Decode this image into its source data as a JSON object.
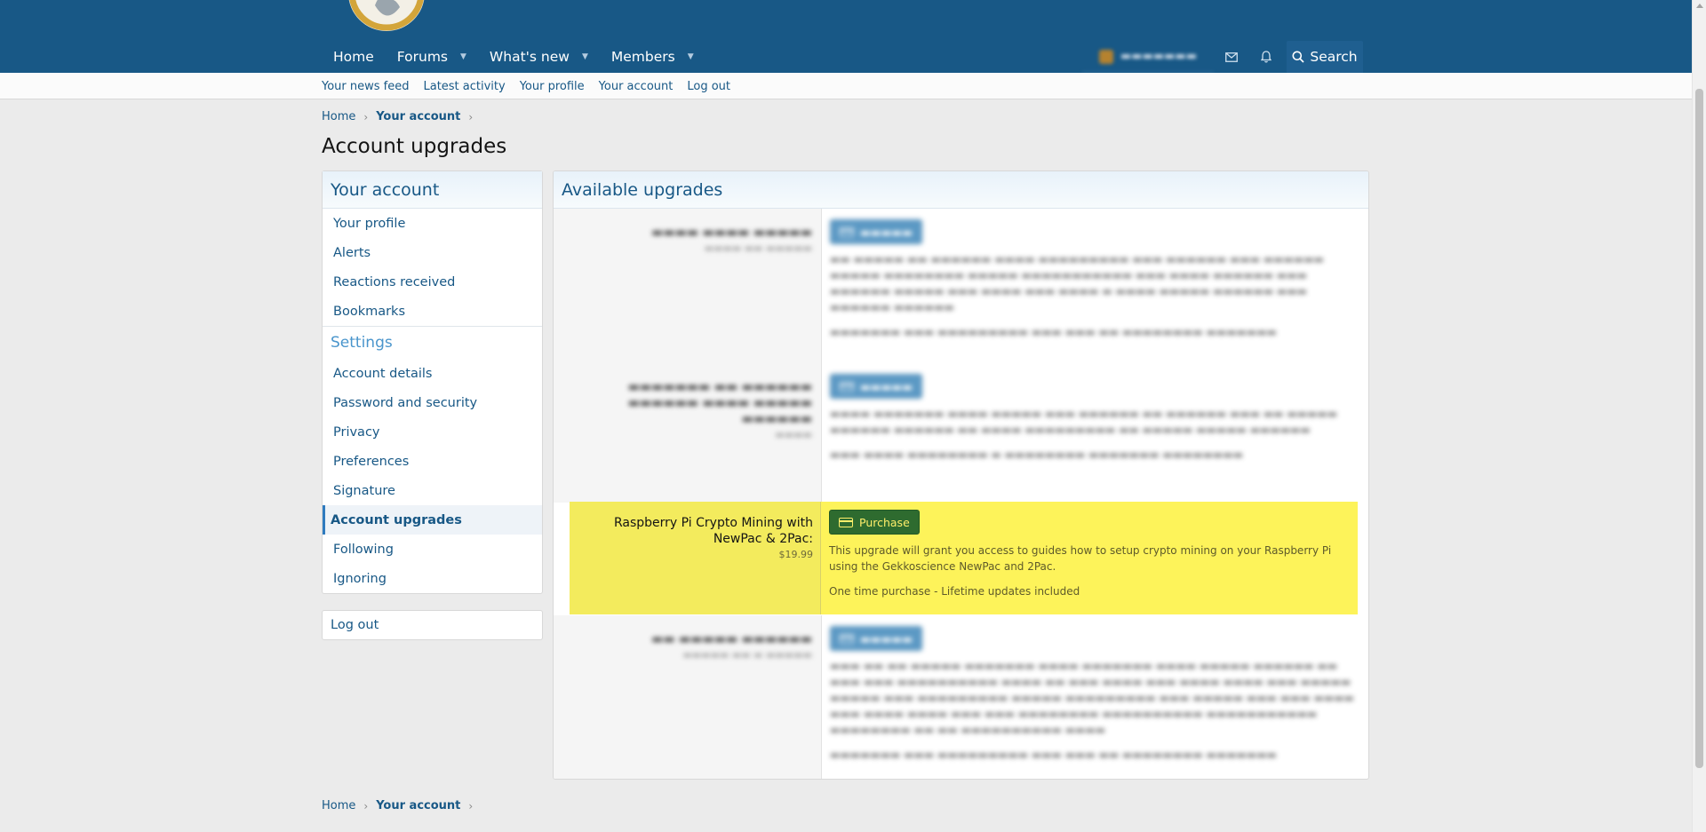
{
  "header": {
    "nav": [
      {
        "label": "Home",
        "dropdown": false
      },
      {
        "label": "Forums",
        "dropdown": true
      },
      {
        "label": "What's new",
        "dropdown": true
      },
      {
        "label": "Members",
        "dropdown": true
      }
    ],
    "search_label": "Search"
  },
  "subnav": {
    "links": [
      "Your news feed",
      "Latest activity",
      "Your profile",
      "Your account",
      "Log out"
    ]
  },
  "breadcrumb": {
    "home": "Home",
    "current": "Your account"
  },
  "page_title": "Account upgrades",
  "sidebar": {
    "title": "Your account",
    "items": [
      "Your profile",
      "Alerts",
      "Reactions received",
      "Bookmarks"
    ],
    "settings_title": "Settings",
    "settings_items": [
      "Account details",
      "Password and security",
      "Privacy",
      "Preferences",
      "Signature",
      "Account upgrades",
      "Following",
      "Ignoring"
    ],
    "selected": "Account upgrades",
    "logout": "Log out"
  },
  "main": {
    "title": "Available upgrades",
    "highlighted_upgrade": {
      "title": "Raspberry Pi Crypto Mining with NewPac & 2Pac:",
      "price": "$19.99",
      "button": "Purchase",
      "description": "This upgrade will grant you access to guides how to setup crypto mining on your Raspberry Pi using the Gekkoscience NewPac and 2Pac.",
      "note": "One time purchase - Lifetime updates included"
    }
  },
  "colors": {
    "header_bg": "#185886",
    "link": "#185886",
    "highlight": "#fdf35a",
    "purchase_button": "#2577b1"
  },
  "icons": [
    "logo-image",
    "chevron-down-icon",
    "mail-icon",
    "bell-icon",
    "search-icon",
    "credit-card-icon"
  ]
}
